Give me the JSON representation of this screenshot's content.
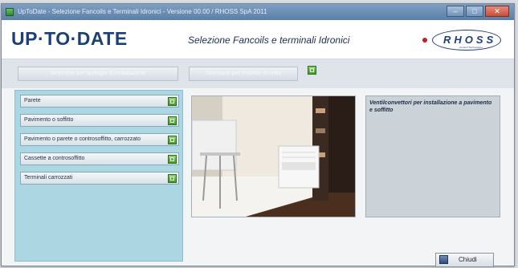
{
  "window": {
    "title": "UpToDate - Selezione Fancoils e Terminali Idronici - Versione 00.00 / RHOSS SpA 2011",
    "buttons": [
      "–",
      "□",
      "✕"
    ]
  },
  "header": {
    "app_logo": "UP·TO·DATE",
    "subtitle": "Selezione Fancoils e terminali Idronici",
    "brand_logo": "RHOSS",
    "brand_tagline": "Comfort Technologies"
  },
  "toolbar": {
    "button1_label": "Selezione per tipologia di installazione",
    "button2_label": "Selezione per modello di unità"
  },
  "categories": [
    {
      "label": "Parete"
    },
    {
      "label": "Pavimento o soffitto"
    },
    {
      "label": "Pavimento o parete o controsoffitto, carrozzato"
    },
    {
      "label": "Cassette a controsoffitto"
    },
    {
      "label": "Terminali carrozzati"
    }
  ],
  "description": "Ventilconvettori per installazione a pavimento e soffitto",
  "footer": {
    "exit_label": "Chiudi"
  },
  "colors": {
    "left_panel_bg": "#abd6e2",
    "brand_blue": "#1d3f78",
    "accent_green": "#3f9b2b"
  }
}
